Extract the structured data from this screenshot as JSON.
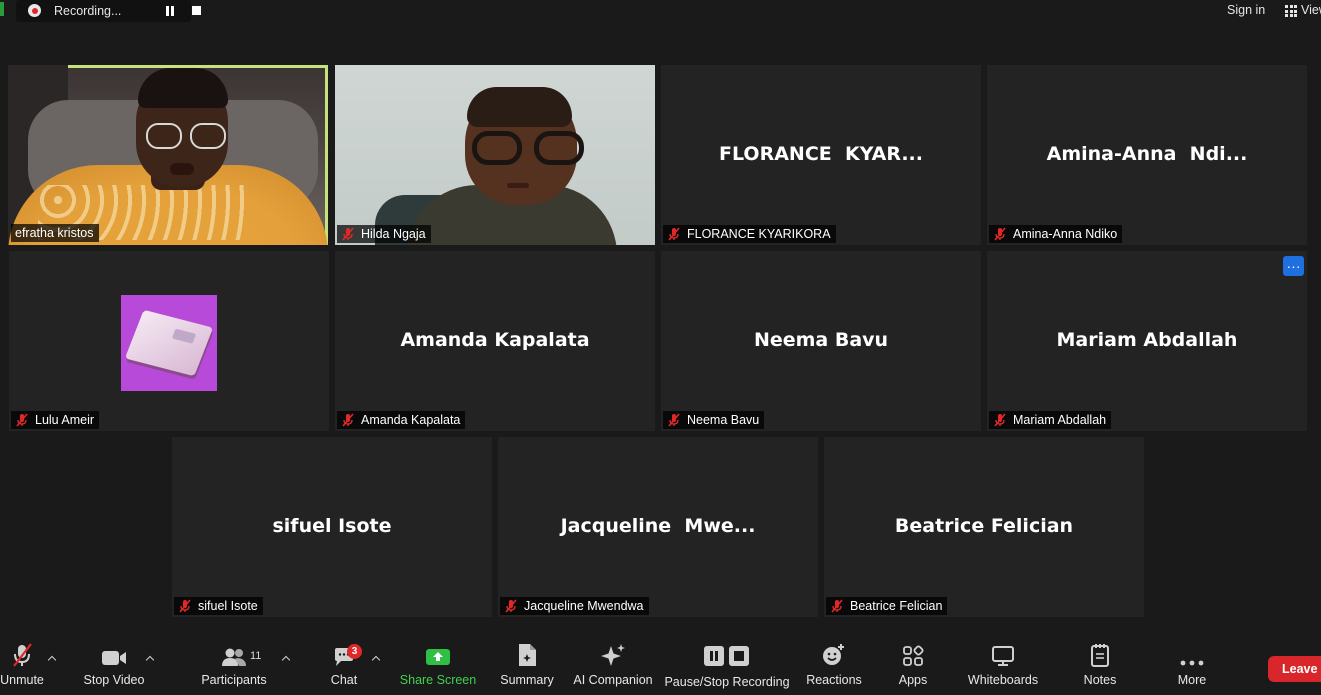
{
  "top_bar": {
    "recording_label": "Recording...",
    "sign_in": "Sign in",
    "view_label": "View"
  },
  "tiles": {
    "efratha": {
      "name": "efratha kristos",
      "active": true
    },
    "hilda": {
      "name": "Hilda Ngaja"
    },
    "florance": {
      "display": "FLORANCE  KYAR...",
      "name": "FLORANCE KYARIKORA"
    },
    "amina": {
      "display": "Amina-Anna  Ndi...",
      "name": "Amina-Anna Ndiko"
    },
    "lulu": {
      "name": "Lulu Ameir"
    },
    "amanda": {
      "display": "Amanda Kapalata",
      "name": "Amanda Kapalata"
    },
    "neema": {
      "display": "Neema Bavu",
      "name": "Neema Bavu"
    },
    "mariam": {
      "display": "Mariam Abdallah",
      "name": "Mariam Abdallah"
    },
    "sifuel": {
      "display": "sifuel Isote",
      "name": "sifuel Isote"
    },
    "jacqueline": {
      "display": "Jacqueline  Mwe...",
      "name": "Jacqueline Mwendwa"
    },
    "beatrice": {
      "display": "Beatrice Felician",
      "name": "Beatrice Felician"
    }
  },
  "more_options_glyph": "···",
  "toolbar": {
    "unmute": "Unmute",
    "stop_video": "Stop Video",
    "participants": "Participants",
    "participants_count": "11",
    "chat": "Chat",
    "chat_badge": "3",
    "share_screen": "Share Screen",
    "summary": "Summary",
    "ai_companion": "AI Companion",
    "pause_stop_recording": "Pause/Stop Recording",
    "reactions": "Reactions",
    "apps": "Apps",
    "whiteboards": "Whiteboards",
    "notes": "Notes",
    "more": "More",
    "leave": "Leave"
  },
  "colors": {
    "background": "#1a1a1a",
    "tile": "#232323",
    "active_speaker_border": "#c6e27a",
    "share_green": "#3fd14f",
    "leave_red": "#d9262b",
    "mute_red": "#e02828",
    "more_blue": "#1f6fe0"
  }
}
